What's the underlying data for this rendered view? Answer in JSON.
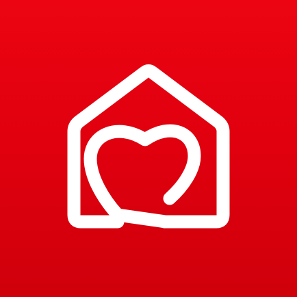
{
  "app_icon": {
    "icon": "house-heart-icon",
    "background_color": "#e3000f",
    "foreground_color": "#ffffff"
  }
}
